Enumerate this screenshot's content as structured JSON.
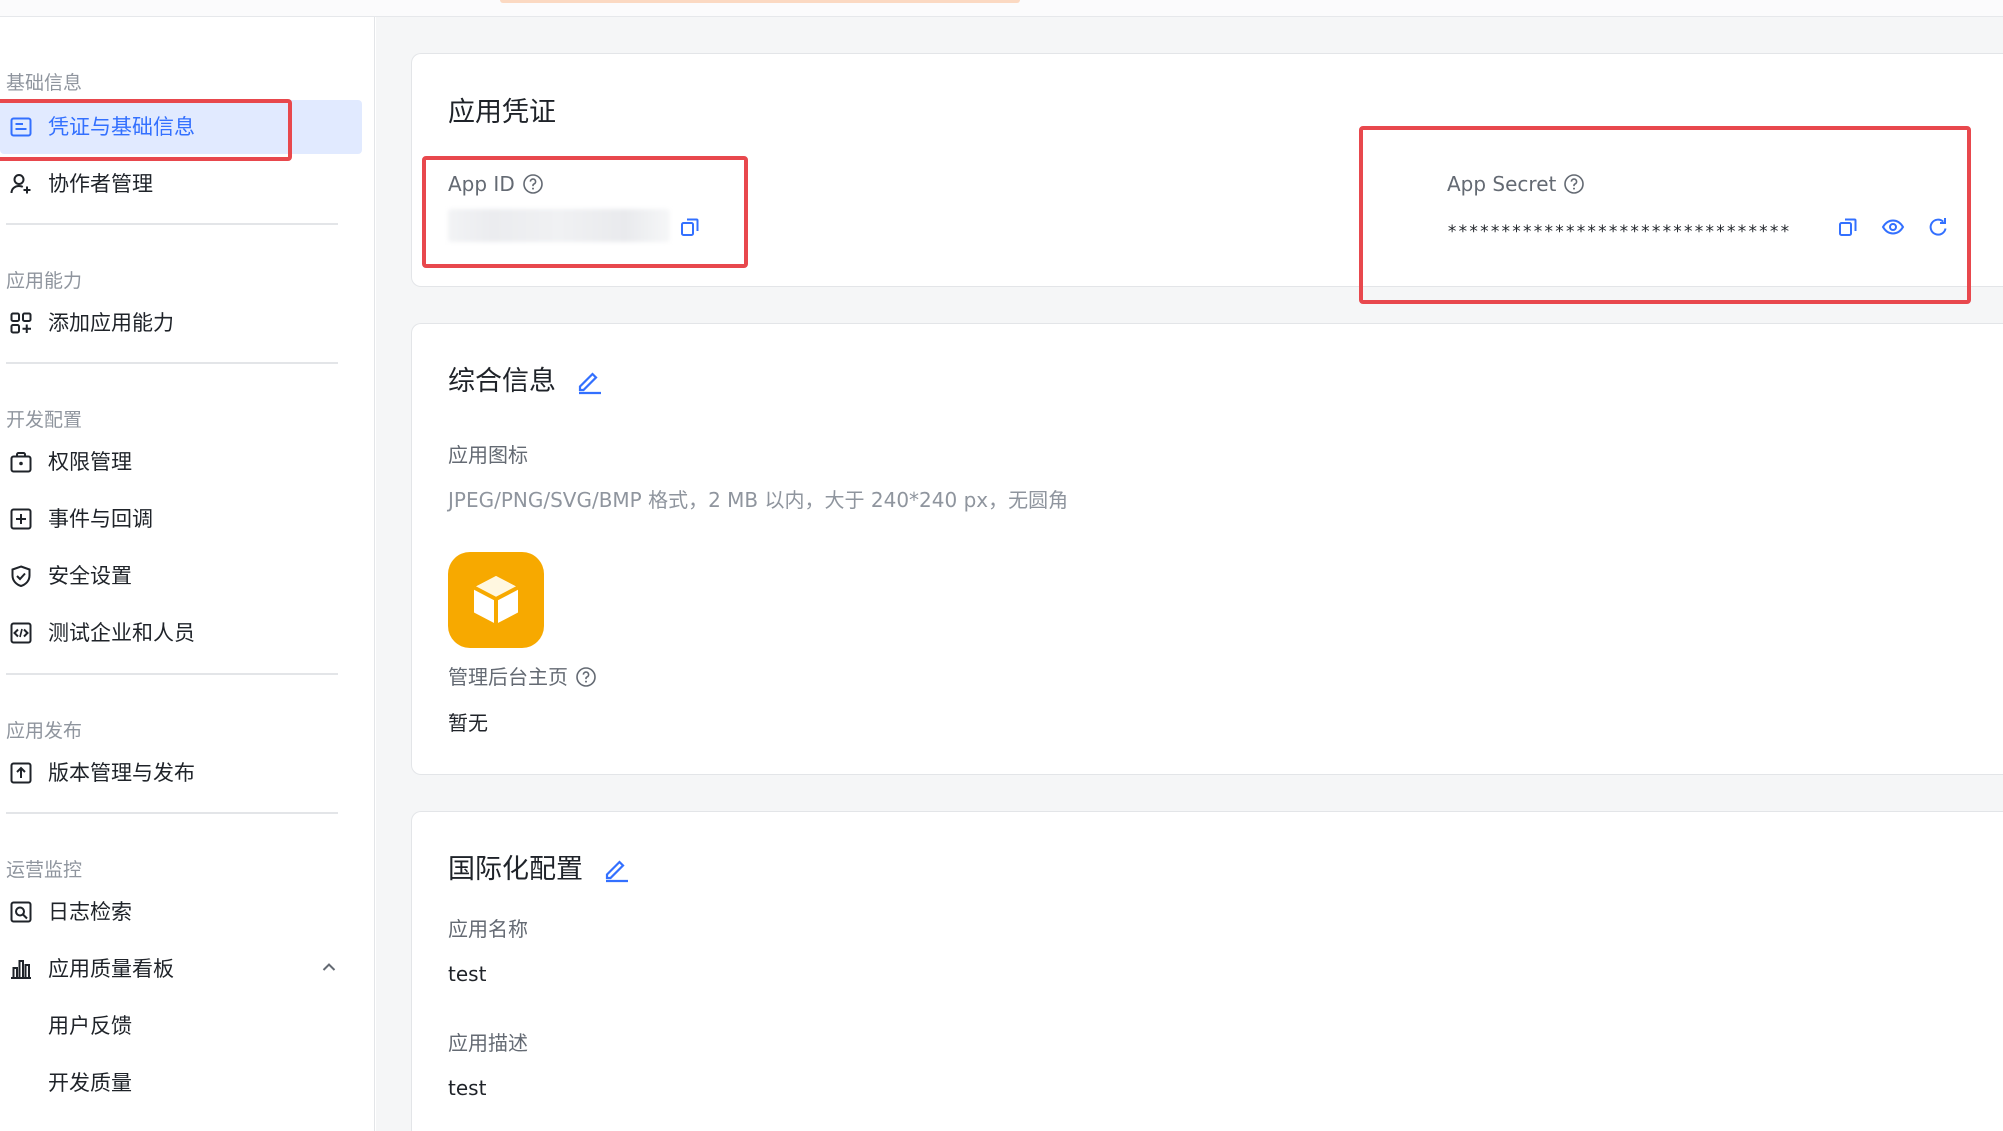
{
  "sidebar": {
    "groups": [
      {
        "title": "基础信息"
      },
      {
        "title": "应用能力"
      },
      {
        "title": "开发配置"
      },
      {
        "title": "应用发布"
      },
      {
        "title": "运营监控"
      }
    ],
    "items": [
      {
        "label": "凭证与基础信息",
        "icon": "credential-card-icon",
        "active": true
      },
      {
        "label": "协作者管理",
        "icon": "user-add-icon"
      },
      {
        "label": "添加应用能力",
        "icon": "app-grid-add-icon"
      },
      {
        "label": "权限管理",
        "icon": "permission-bag-icon"
      },
      {
        "label": "事件与回调",
        "icon": "event-plus-icon"
      },
      {
        "label": "安全设置",
        "icon": "shield-check-icon"
      },
      {
        "label": "测试企业和人员",
        "icon": "code-box-icon"
      },
      {
        "label": "版本管理与发布",
        "icon": "upload-box-icon"
      },
      {
        "label": "日志检索",
        "icon": "log-search-icon"
      },
      {
        "label": "应用质量看板",
        "icon": "bar-chart-icon",
        "expanded": true
      },
      {
        "label": "用户反馈"
      },
      {
        "label": "开发质量"
      }
    ]
  },
  "credentials": {
    "title": "应用凭证",
    "app_id_label": "App ID",
    "app_secret_label": "App Secret",
    "app_secret_value": "********************************"
  },
  "general": {
    "title": "综合信息",
    "icon_label": "应用图标",
    "icon_hint": "JPEG/PNG/SVG/BMP 格式，2 MB 以内，大于 240*240 px，无圆角",
    "admin_home_label": "管理后台主页",
    "admin_home_value": "暂无"
  },
  "i18n": {
    "title": "国际化配置",
    "name_label": "应用名称",
    "name_value": "test",
    "desc_label": "应用描述",
    "desc_value": "test"
  },
  "colors": {
    "accent": "#3370ff",
    "active_bg": "#e1eaff",
    "highlight_red": "#e8484d",
    "app_icon": "#f7a900"
  }
}
